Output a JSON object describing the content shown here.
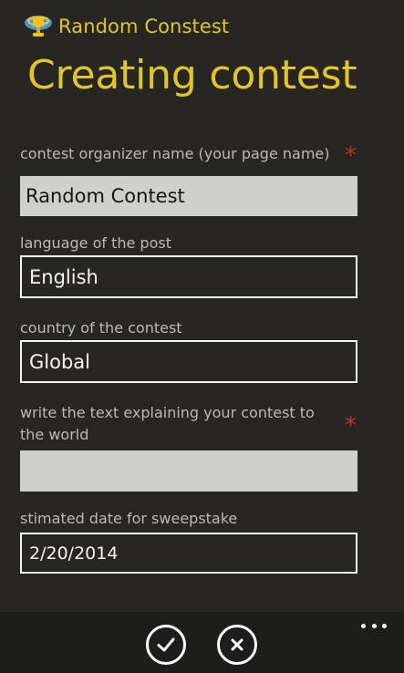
{
  "app": {
    "name": "Random Constest",
    "logo_icon": "trophy-globe-icon"
  },
  "page": {
    "title": "Creating contest"
  },
  "colors": {
    "accent": "#e3c625",
    "background": "#282622",
    "required": "#c0301e",
    "app_bar": "#1d1d1b"
  },
  "form": {
    "organizer": {
      "label": "contest organizer name (your page name)",
      "required_mark": "*",
      "value": "Random Contest"
    },
    "language": {
      "label": "language of the post",
      "value": "English"
    },
    "country": {
      "label": "country of the contest",
      "value": "Global"
    },
    "description": {
      "label": "write the text explaining your contest to the world",
      "required_mark": "*",
      "value": ""
    },
    "date": {
      "label": "stimated date for sweepstake",
      "value": "2/20/2014"
    }
  },
  "app_bar": {
    "buttons": [
      {
        "icon": "check-icon"
      },
      {
        "icon": "close-icon"
      }
    ],
    "more_icon": "more-dots-icon"
  }
}
